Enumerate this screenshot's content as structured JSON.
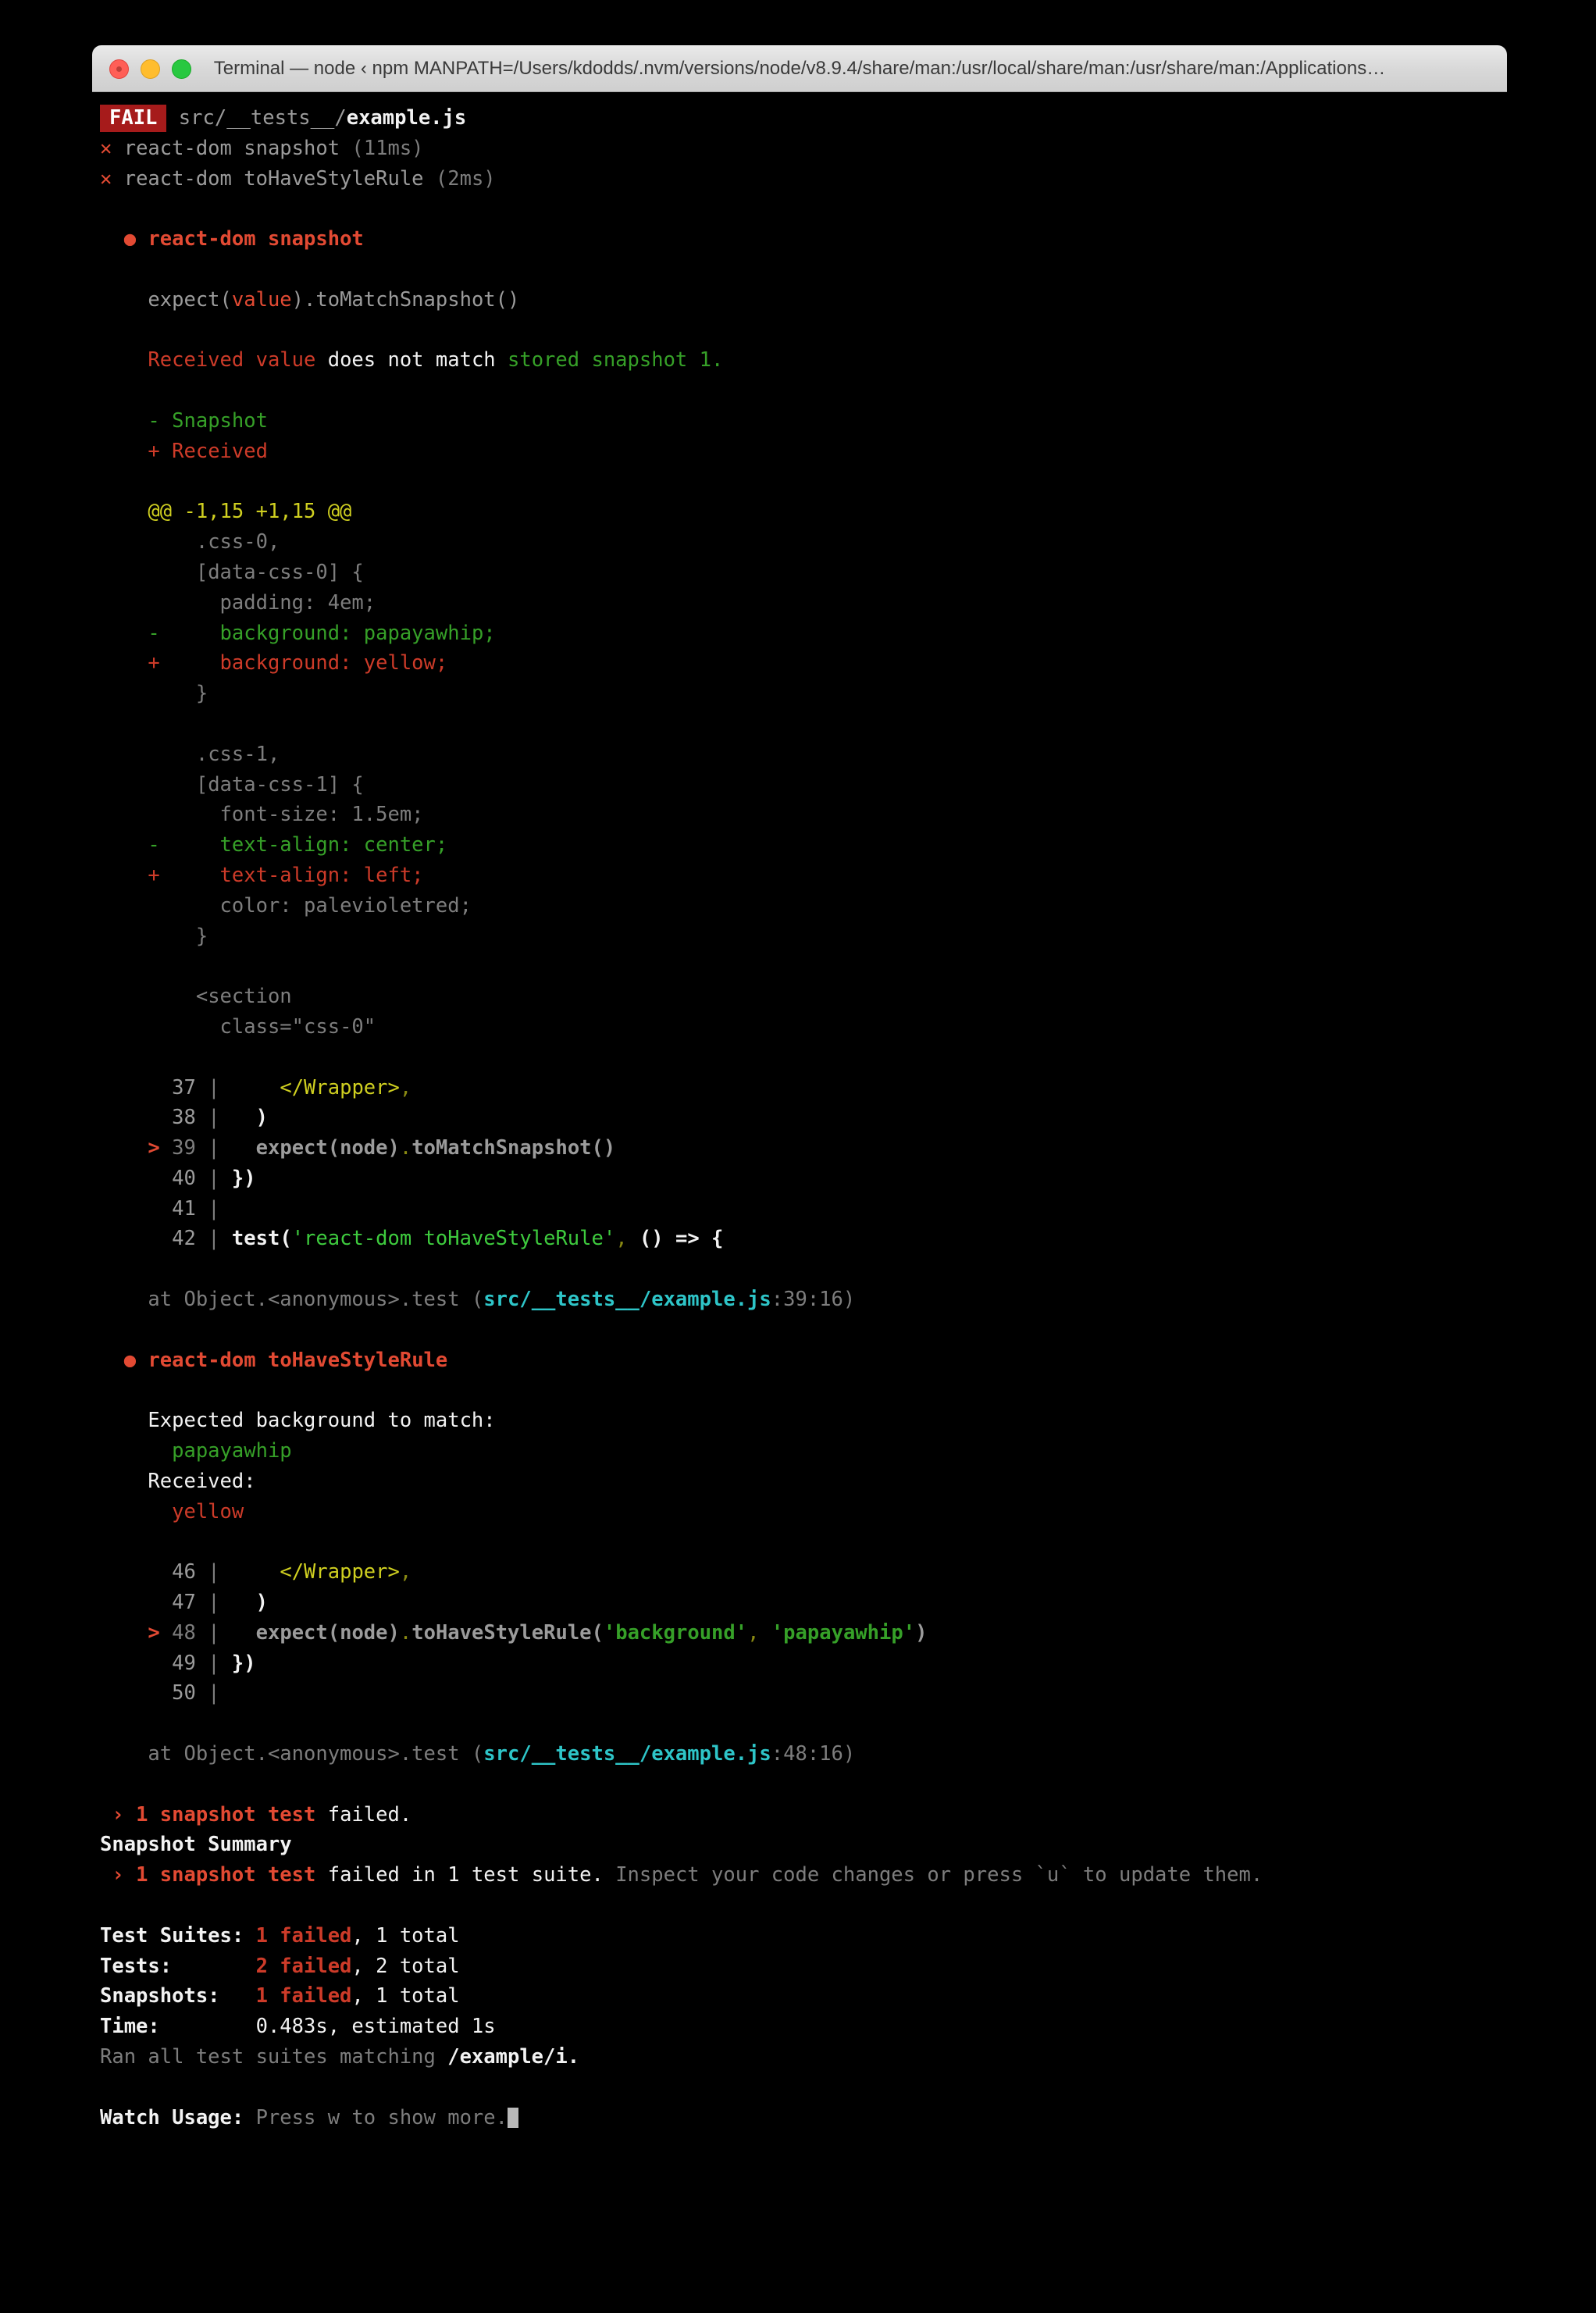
{
  "window": {
    "title": "Terminal — node ‹ npm MANPATH=/Users/kdodds/.nvm/versions/node/v8.9.4/share/man:/usr/local/share/man:/usr/share/man:/Applications…",
    "controls": {
      "close": "close-button",
      "minimize": "minimize-button",
      "zoom": "zoom-button"
    }
  },
  "terminal": {
    "fail_badge": "FAIL",
    "suite_path_prefix": "src/__tests__/",
    "suite_file": "example.js",
    "test_results": [
      {
        "mark": "✕",
        "name": "react-dom snapshot",
        "time": "(11ms)"
      },
      {
        "mark": "✕",
        "name": "react-dom toHaveStyleRule",
        "time": "(2ms)"
      }
    ],
    "failure1": {
      "bullet": "●",
      "title": "react-dom snapshot",
      "matcher_prefix": "expect(",
      "matcher_arg": "value",
      "matcher_suffix": ").toMatchSnapshot()",
      "received_label": "Received value",
      "middle_text": " does not match ",
      "stored_label": "stored snapshot 1.",
      "legend_minus_sign": "- ",
      "legend_minus": "Snapshot",
      "legend_plus_sign": "+ ",
      "legend_plus": "Received",
      "hunk_header": "@@ -1,15 +1,15 @@",
      "diff_lines": [
        {
          "marker": "  ",
          "text": ".css-0,",
          "kind": "context"
        },
        {
          "marker": "  ",
          "text": "[data-css-0] {",
          "kind": "context"
        },
        {
          "marker": "  ",
          "text": "  padding: 4em;",
          "kind": "context"
        },
        {
          "marker": "- ",
          "text": "  background: papayawhip;",
          "kind": "removed"
        },
        {
          "marker": "+ ",
          "text": "  background: yellow;",
          "kind": "added"
        },
        {
          "marker": "  ",
          "text": "}",
          "kind": "context"
        },
        {
          "marker": "  ",
          "text": "",
          "kind": "context"
        },
        {
          "marker": "  ",
          "text": ".css-1,",
          "kind": "context"
        },
        {
          "marker": "  ",
          "text": "[data-css-1] {",
          "kind": "context"
        },
        {
          "marker": "  ",
          "text": "  font-size: 1.5em;",
          "kind": "context"
        },
        {
          "marker": "- ",
          "text": "  text-align: center;",
          "kind": "removed"
        },
        {
          "marker": "+ ",
          "text": "  text-align: left;",
          "kind": "added"
        },
        {
          "marker": "  ",
          "text": "  color: palevioletred;",
          "kind": "context"
        },
        {
          "marker": "  ",
          "text": "}",
          "kind": "context"
        },
        {
          "marker": "  ",
          "text": "",
          "kind": "context"
        },
        {
          "marker": "  ",
          "text": "<section",
          "kind": "context"
        },
        {
          "marker": "  ",
          "text": "  class=\"css-0\"",
          "kind": "context"
        }
      ],
      "code_frame": [
        {
          "pointer": "  ",
          "num": "37",
          "bar": "|",
          "code": "    </Wrapper>,"
        },
        {
          "pointer": "  ",
          "num": "38",
          "bar": "|",
          "code": "  )"
        },
        {
          "pointer": "> ",
          "num": "39",
          "bar": "|",
          "code": "  expect(node).toMatchSnapshot()"
        },
        {
          "pointer": "  ",
          "num": "40",
          "bar": "|",
          "code": "})"
        },
        {
          "pointer": "  ",
          "num": "41",
          "bar": "|",
          "code": ""
        },
        {
          "pointer": "  ",
          "num": "42",
          "bar": "|",
          "code": "test('react-dom toHaveStyleRule', () => {"
        }
      ],
      "stack_prefix": "at Object.<anonymous>.test (",
      "stack_path": "src/__tests__/example.js",
      "stack_pos": ":39:16)"
    },
    "failure2": {
      "bullet": "●",
      "title": "react-dom toHaveStyleRule",
      "expected_label": "Expected background to match:",
      "expected_value": "papayawhip",
      "received_label": "Received:",
      "received_value": "yellow",
      "code_frame": [
        {
          "pointer": "  ",
          "num": "46",
          "bar": "|",
          "code": "    </Wrapper>,"
        },
        {
          "pointer": "  ",
          "num": "47",
          "bar": "|",
          "code": "  )"
        },
        {
          "pointer": "> ",
          "num": "48",
          "bar": "|",
          "code": "  expect(node).toHaveStyleRule('background', 'papayawhip')"
        },
        {
          "pointer": "  ",
          "num": "49",
          "bar": "|",
          "code": "})"
        },
        {
          "pointer": "  ",
          "num": "50",
          "bar": "|",
          "code": ""
        }
      ],
      "stack_prefix": "at Object.<anonymous>.test (",
      "stack_path": "src/__tests__/example.js",
      "stack_pos": ":48:16)"
    },
    "summary": {
      "snapshot_fail_arrow": "› ",
      "snapshot_fail_count": "1 snapshot test",
      "snapshot_fail_rest": " failed.",
      "heading": "Snapshot Summary",
      "suite_arrow": "› ",
      "suite_count": "1 snapshot test",
      "suite_rest": " failed in 1 test suite.",
      "suite_hint": " Inspect your code changes or press `u` to update them.",
      "stats": [
        {
          "label": "Test Suites:",
          "pad": " ",
          "failed": "1 failed",
          "rest": ", 1 total"
        },
        {
          "label": "Tests:",
          "pad": "       ",
          "failed": "2 failed",
          "rest": ", 2 total"
        },
        {
          "label": "Snapshots:",
          "pad": "   ",
          "failed": "1 failed",
          "rest": ", 1 total"
        }
      ],
      "time_label": "Time:",
      "time_pad": "        ",
      "time_value": "0.483s, estimated 1s",
      "ran_prefix": "Ran all test suites matching ",
      "ran_pattern": "/example/i.",
      "watch_label": "Watch Usage:",
      "watch_hint": " Press w to show more."
    }
  }
}
